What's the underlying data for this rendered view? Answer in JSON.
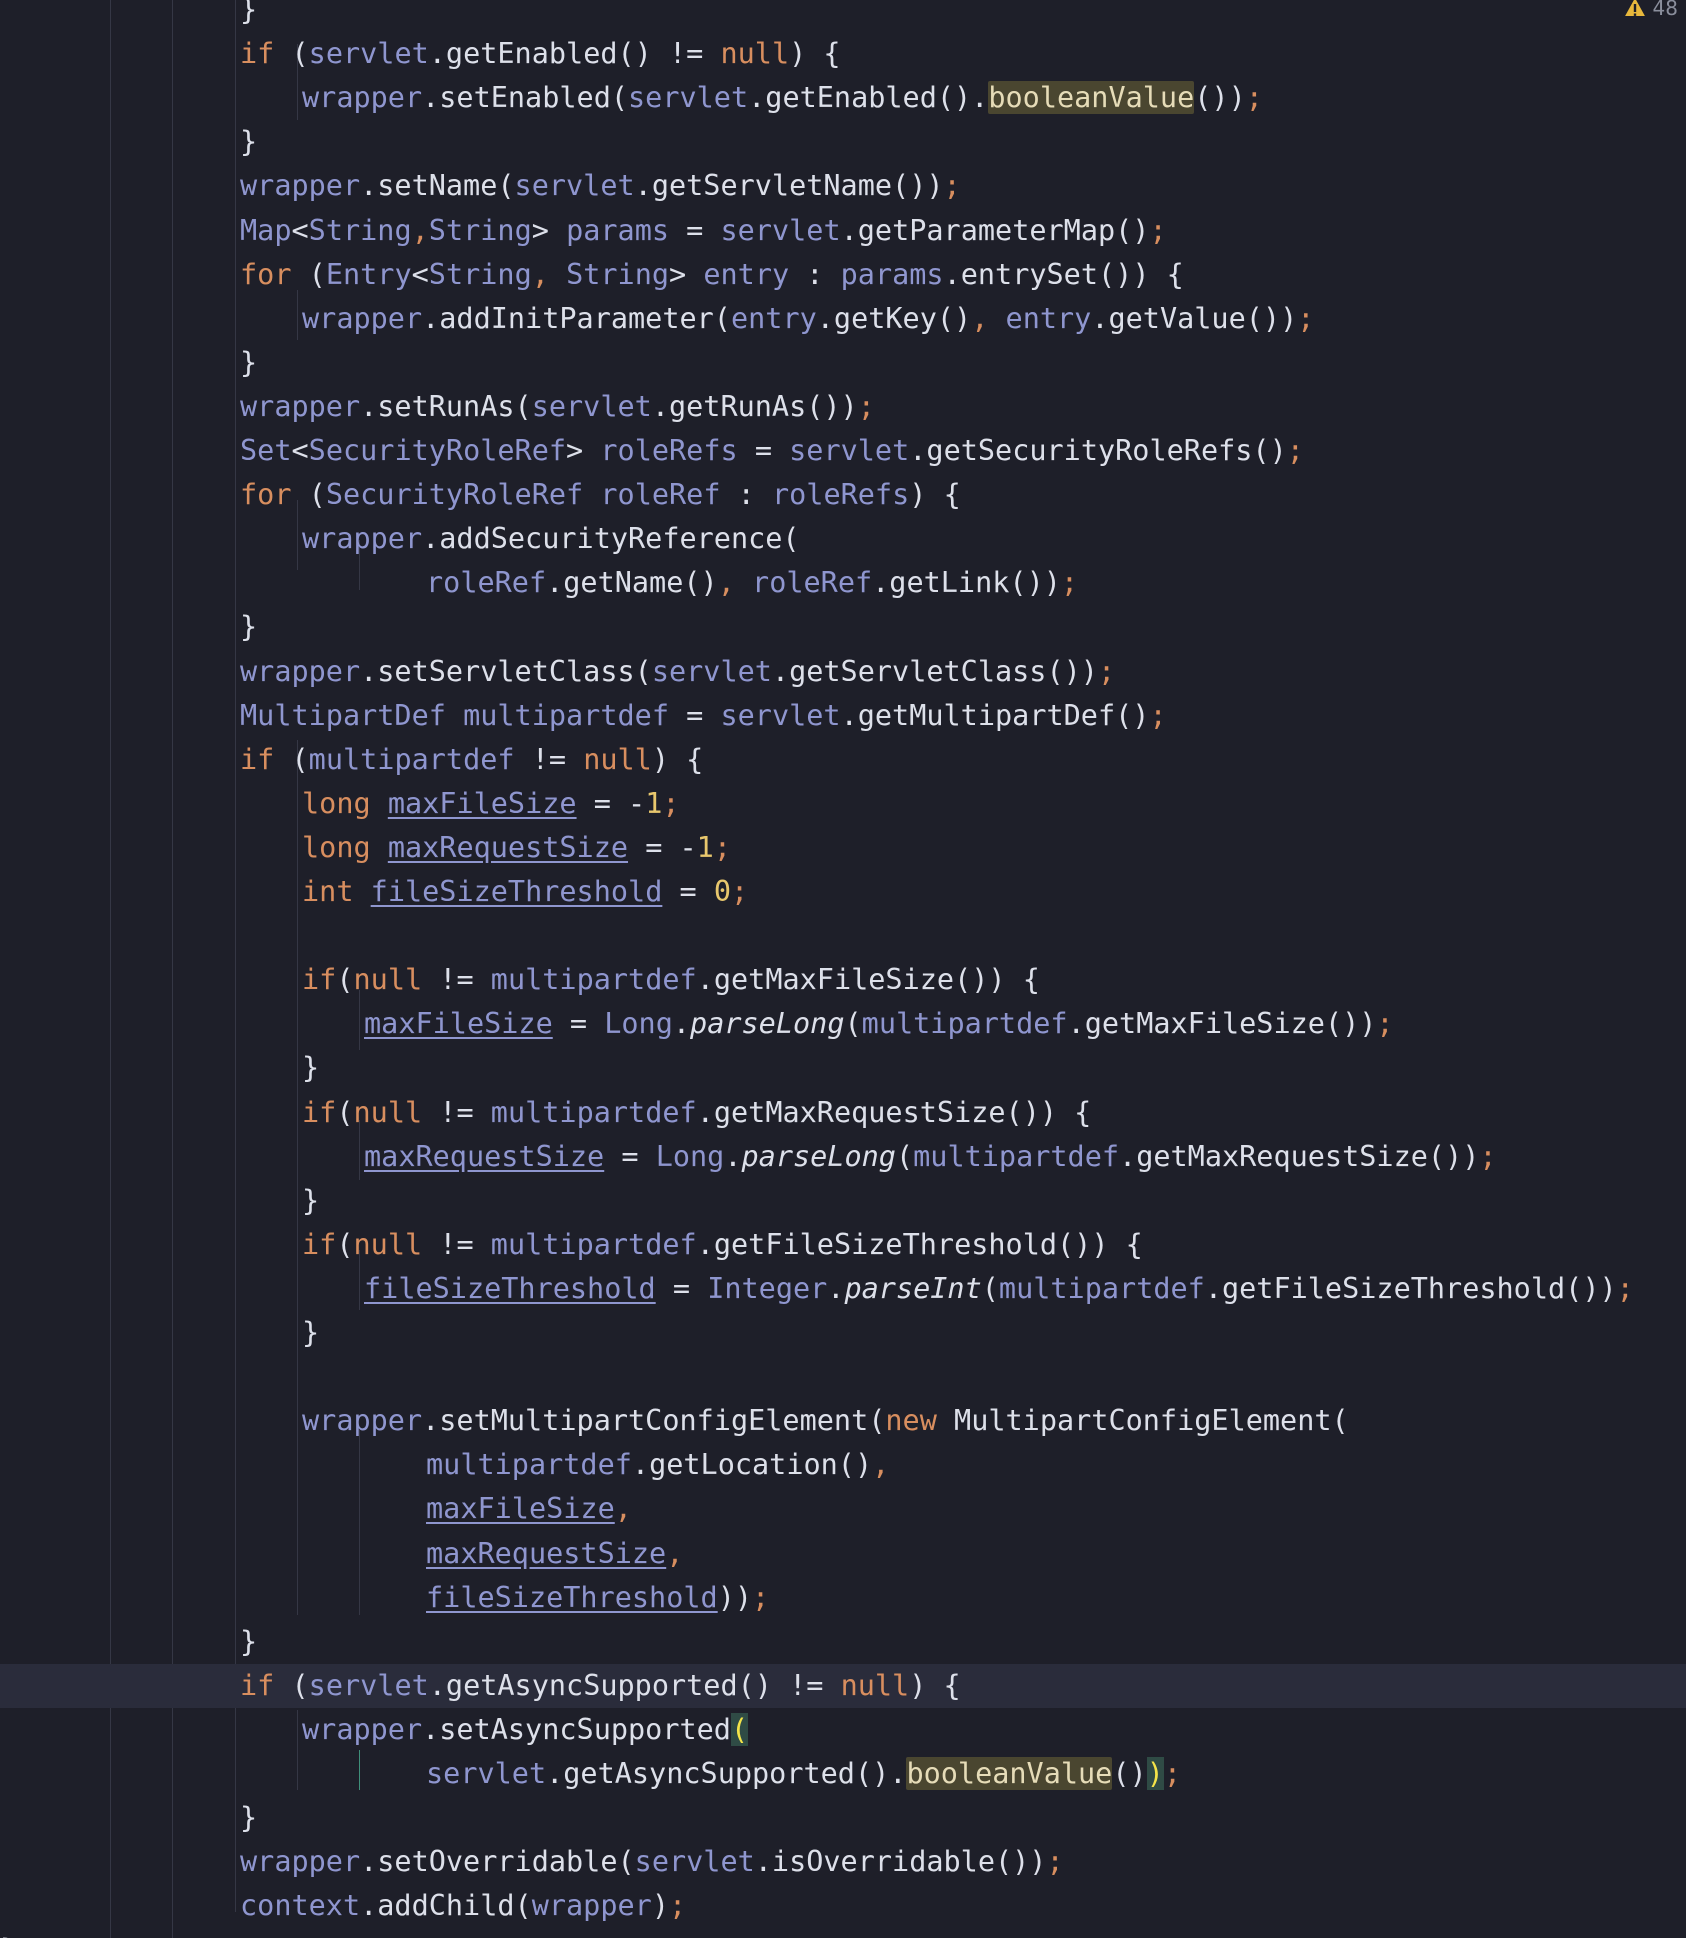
{
  "editor": {
    "language": "java",
    "inspection_widget": {
      "icon": "warning-triangle-icon",
      "warning_count": "48",
      "color": "#e8b83c"
    },
    "current_line_index": 38,
    "colors": {
      "background": "#1e1f29",
      "keyword": "#d88e5f",
      "variable": "#8f96cf",
      "text": "#dde0ea",
      "number": "#e8c76d",
      "current_line": "#2a2c3b",
      "usage_highlight": "#4a4630"
    },
    "lines": [
      [
        {
          "t": "}",
          "c": "plain"
        }
      ],
      [
        {
          "t": "if",
          "c": "kw"
        },
        {
          "t": " (",
          "c": "plain"
        },
        {
          "t": "servlet",
          "c": "var"
        },
        {
          "t": ".getEnabled() != ",
          "c": "plain"
        },
        {
          "t": "null",
          "c": "kw"
        },
        {
          "t": ") {",
          "c": "plain"
        }
      ],
      [
        {
          "t": "wrapper",
          "c": "var"
        },
        {
          "t": ".setEnabled(",
          "c": "plain"
        },
        {
          "t": "servlet",
          "c": "var"
        },
        {
          "t": ".getEnabled().",
          "c": "plain"
        },
        {
          "t": "booleanValue",
          "c": "hl"
        },
        {
          "t": "())",
          "c": "plain"
        },
        {
          "t": ";",
          "c": "punct"
        }
      ],
      [
        {
          "t": "}",
          "c": "plain"
        }
      ],
      [
        {
          "t": "wrapper",
          "c": "var"
        },
        {
          "t": ".setName(",
          "c": "plain"
        },
        {
          "t": "servlet",
          "c": "var"
        },
        {
          "t": ".getServletName())",
          "c": "plain"
        },
        {
          "t": ";",
          "c": "punct"
        }
      ],
      [
        {
          "t": "Map",
          "c": "var"
        },
        {
          "t": "<",
          "c": "plain"
        },
        {
          "t": "String",
          "c": "var"
        },
        {
          "t": ",",
          "c": "punct"
        },
        {
          "t": "String",
          "c": "var"
        },
        {
          "t": "> ",
          "c": "plain"
        },
        {
          "t": "params",
          "c": "var"
        },
        {
          "t": " = ",
          "c": "plain"
        },
        {
          "t": "servlet",
          "c": "var"
        },
        {
          "t": ".getParameterMap()",
          "c": "plain"
        },
        {
          "t": ";",
          "c": "punct"
        }
      ],
      [
        {
          "t": "for",
          "c": "kw"
        },
        {
          "t": " (",
          "c": "plain"
        },
        {
          "t": "Entry",
          "c": "var"
        },
        {
          "t": "<",
          "c": "plain"
        },
        {
          "t": "String",
          "c": "var"
        },
        {
          "t": ", ",
          "c": "punct"
        },
        {
          "t": "String",
          "c": "var"
        },
        {
          "t": "> ",
          "c": "plain"
        },
        {
          "t": "entry",
          "c": "var"
        },
        {
          "t": " : ",
          "c": "plain"
        },
        {
          "t": "params",
          "c": "var"
        },
        {
          "t": ".entrySet()) {",
          "c": "plain"
        }
      ],
      [
        {
          "t": "wrapper",
          "c": "var"
        },
        {
          "t": ".addInitParameter(",
          "c": "plain"
        },
        {
          "t": "entry",
          "c": "var"
        },
        {
          "t": ".getKey()",
          "c": "plain"
        },
        {
          "t": ", ",
          "c": "punct"
        },
        {
          "t": "entry",
          "c": "var"
        },
        {
          "t": ".getValue())",
          "c": "plain"
        },
        {
          "t": ";",
          "c": "punct"
        }
      ],
      [
        {
          "t": "}",
          "c": "plain"
        }
      ],
      [
        {
          "t": "wrapper",
          "c": "var"
        },
        {
          "t": ".setRunAs(",
          "c": "plain"
        },
        {
          "t": "servlet",
          "c": "var"
        },
        {
          "t": ".getRunAs())",
          "c": "plain"
        },
        {
          "t": ";",
          "c": "punct"
        }
      ],
      [
        {
          "t": "Set",
          "c": "var"
        },
        {
          "t": "<",
          "c": "plain"
        },
        {
          "t": "SecurityRoleRef",
          "c": "var"
        },
        {
          "t": "> ",
          "c": "plain"
        },
        {
          "t": "roleRefs",
          "c": "var"
        },
        {
          "t": " = ",
          "c": "plain"
        },
        {
          "t": "servlet",
          "c": "var"
        },
        {
          "t": ".getSecurityRoleRefs()",
          "c": "plain"
        },
        {
          "t": ";",
          "c": "punct"
        }
      ],
      [
        {
          "t": "for",
          "c": "kw"
        },
        {
          "t": " (",
          "c": "plain"
        },
        {
          "t": "SecurityRoleRef",
          "c": "var"
        },
        {
          "t": " ",
          "c": "plain"
        },
        {
          "t": "roleRef",
          "c": "var"
        },
        {
          "t": " : ",
          "c": "plain"
        },
        {
          "t": "roleRefs",
          "c": "var"
        },
        {
          "t": ") {",
          "c": "plain"
        }
      ],
      [
        {
          "t": "wrapper",
          "c": "var"
        },
        {
          "t": ".addSecurityReference(",
          "c": "plain"
        }
      ],
      [
        {
          "t": "roleRef",
          "c": "var"
        },
        {
          "t": ".getName()",
          "c": "plain"
        },
        {
          "t": ", ",
          "c": "punct"
        },
        {
          "t": "roleRef",
          "c": "var"
        },
        {
          "t": ".getLink())",
          "c": "plain"
        },
        {
          "t": ";",
          "c": "punct"
        }
      ],
      [
        {
          "t": "}",
          "c": "plain"
        }
      ],
      [
        {
          "t": "wrapper",
          "c": "var"
        },
        {
          "t": ".setServletClass(",
          "c": "plain"
        },
        {
          "t": "servlet",
          "c": "var"
        },
        {
          "t": ".getServletClass())",
          "c": "plain"
        },
        {
          "t": ";",
          "c": "punct"
        }
      ],
      [
        {
          "t": "MultipartDef",
          "c": "var"
        },
        {
          "t": " ",
          "c": "plain"
        },
        {
          "t": "multipartdef",
          "c": "var"
        },
        {
          "t": " = ",
          "c": "plain"
        },
        {
          "t": "servlet",
          "c": "var"
        },
        {
          "t": ".getMultipartDef()",
          "c": "plain"
        },
        {
          "t": ";",
          "c": "punct"
        }
      ],
      [
        {
          "t": "if",
          "c": "kw"
        },
        {
          "t": " (",
          "c": "plain"
        },
        {
          "t": "multipartdef",
          "c": "var"
        },
        {
          "t": " != ",
          "c": "plain"
        },
        {
          "t": "null",
          "c": "kw"
        },
        {
          "t": ") {",
          "c": "plain"
        }
      ],
      [
        {
          "t": "long",
          "c": "kw"
        },
        {
          "t": " ",
          "c": "plain"
        },
        {
          "t": "maxFileSize",
          "c": "var ul"
        },
        {
          "t": " = -",
          "c": "plain"
        },
        {
          "t": "1",
          "c": "num"
        },
        {
          "t": ";",
          "c": "punct"
        }
      ],
      [
        {
          "t": "long",
          "c": "kw"
        },
        {
          "t": " ",
          "c": "plain"
        },
        {
          "t": "maxRequestSize",
          "c": "var ul"
        },
        {
          "t": " = -",
          "c": "plain"
        },
        {
          "t": "1",
          "c": "num"
        },
        {
          "t": ";",
          "c": "punct"
        }
      ],
      [
        {
          "t": "int",
          "c": "kw"
        },
        {
          "t": " ",
          "c": "plain"
        },
        {
          "t": "fileSizeThreshold",
          "c": "var ul"
        },
        {
          "t": " = ",
          "c": "plain"
        },
        {
          "t": "0",
          "c": "num"
        },
        {
          "t": ";",
          "c": "punct"
        }
      ],
      [],
      [
        {
          "t": "if",
          "c": "kw"
        },
        {
          "t": "(",
          "c": "plain"
        },
        {
          "t": "null",
          "c": "kw"
        },
        {
          "t": " != ",
          "c": "plain"
        },
        {
          "t": "multipartdef",
          "c": "var"
        },
        {
          "t": ".getMaxFileSize()) {",
          "c": "plain"
        }
      ],
      [
        {
          "t": "maxFileSize",
          "c": "var ul"
        },
        {
          "t": " = ",
          "c": "plain"
        },
        {
          "t": "Long",
          "c": "var"
        },
        {
          "t": ".",
          "c": "plain"
        },
        {
          "t": "parseLong",
          "c": "italic"
        },
        {
          "t": "(",
          "c": "plain"
        },
        {
          "t": "multipartdef",
          "c": "var"
        },
        {
          "t": ".getMaxFileSize())",
          "c": "plain"
        },
        {
          "t": ";",
          "c": "punct"
        }
      ],
      [
        {
          "t": "}",
          "c": "plain"
        }
      ],
      [
        {
          "t": "if",
          "c": "kw"
        },
        {
          "t": "(",
          "c": "plain"
        },
        {
          "t": "null",
          "c": "kw"
        },
        {
          "t": " != ",
          "c": "plain"
        },
        {
          "t": "multipartdef",
          "c": "var"
        },
        {
          "t": ".getMaxRequestSize()) {",
          "c": "plain"
        }
      ],
      [
        {
          "t": "maxRequestSize",
          "c": "var ul"
        },
        {
          "t": " = ",
          "c": "plain"
        },
        {
          "t": "Long",
          "c": "var"
        },
        {
          "t": ".",
          "c": "plain"
        },
        {
          "t": "parseLong",
          "c": "italic"
        },
        {
          "t": "(",
          "c": "plain"
        },
        {
          "t": "multipartdef",
          "c": "var"
        },
        {
          "t": ".getMaxRequestSize())",
          "c": "plain"
        },
        {
          "t": ";",
          "c": "punct"
        }
      ],
      [
        {
          "t": "}",
          "c": "plain"
        }
      ],
      [
        {
          "t": "if",
          "c": "kw"
        },
        {
          "t": "(",
          "c": "plain"
        },
        {
          "t": "null",
          "c": "kw"
        },
        {
          "t": " != ",
          "c": "plain"
        },
        {
          "t": "multipartdef",
          "c": "var"
        },
        {
          "t": ".getFileSizeThreshold()) {",
          "c": "plain"
        }
      ],
      [
        {
          "t": "fileSizeThreshold",
          "c": "var ul"
        },
        {
          "t": " = ",
          "c": "plain"
        },
        {
          "t": "Integer",
          "c": "var"
        },
        {
          "t": ".",
          "c": "plain"
        },
        {
          "t": "parseInt",
          "c": "italic"
        },
        {
          "t": "(",
          "c": "plain"
        },
        {
          "t": "multipartdef",
          "c": "var"
        },
        {
          "t": ".getFileSizeThreshold())",
          "c": "plain"
        },
        {
          "t": ";",
          "c": "punct"
        }
      ],
      [
        {
          "t": "}",
          "c": "plain"
        }
      ],
      [],
      [
        {
          "t": "wrapper",
          "c": "var"
        },
        {
          "t": ".setMultipartConfigElement(",
          "c": "plain"
        },
        {
          "t": "new",
          "c": "kw"
        },
        {
          "t": " MultipartConfigElement(",
          "c": "plain"
        }
      ],
      [
        {
          "t": "multipartdef",
          "c": "var"
        },
        {
          "t": ".getLocation()",
          "c": "plain"
        },
        {
          "t": ",",
          "c": "punct"
        }
      ],
      [
        {
          "t": "maxFileSize",
          "c": "var ul"
        },
        {
          "t": ",",
          "c": "punct"
        }
      ],
      [
        {
          "t": "maxRequestSize",
          "c": "var ul"
        },
        {
          "t": ",",
          "c": "punct"
        }
      ],
      [
        {
          "t": "fileSizeThreshold",
          "c": "var ul"
        },
        {
          "t": "))",
          "c": "plain"
        },
        {
          "t": ";",
          "c": "punct"
        }
      ],
      [
        {
          "t": "}",
          "c": "plain"
        }
      ],
      [
        {
          "t": "if",
          "c": "kw"
        },
        {
          "t": " (",
          "c": "plain"
        },
        {
          "t": "servlet",
          "c": "var"
        },
        {
          "t": ".getAsyncSupported() != ",
          "c": "plain"
        },
        {
          "t": "null",
          "c": "kw"
        },
        {
          "t": ") {",
          "c": "plain"
        }
      ],
      [
        {
          "t": "wrapper",
          "c": "var"
        },
        {
          "t": ".setAsyncSupported",
          "c": "plain"
        },
        {
          "t": "(",
          "c": "brace-match"
        }
      ],
      [
        {
          "t": "servlet",
          "c": "var"
        },
        {
          "t": ".getAsyncSupported().",
          "c": "plain"
        },
        {
          "t": "booleanValue",
          "c": "hl"
        },
        {
          "t": "()",
          "c": "plain"
        },
        {
          "t": ")",
          "c": "brace-match"
        },
        {
          "t": ";",
          "c": "punct"
        }
      ],
      [
        {
          "t": "}",
          "c": "plain"
        }
      ],
      [
        {
          "t": "wrapper",
          "c": "var"
        },
        {
          "t": ".setOverridable(",
          "c": "plain"
        },
        {
          "t": "servlet",
          "c": "var"
        },
        {
          "t": ".isOverridable())",
          "c": "plain"
        },
        {
          "t": ";",
          "c": "punct"
        }
      ],
      [
        {
          "t": "context",
          "c": "var"
        },
        {
          "t": ".addChild(",
          "c": "plain"
        },
        {
          "t": "wrapper",
          "c": "var"
        },
        {
          "t": ")",
          "c": "plain"
        },
        {
          "t": ";",
          "c": "punct"
        }
      ],
      [
        {
          "t": "}",
          "c": "plain"
        }
      ]
    ]
  }
}
